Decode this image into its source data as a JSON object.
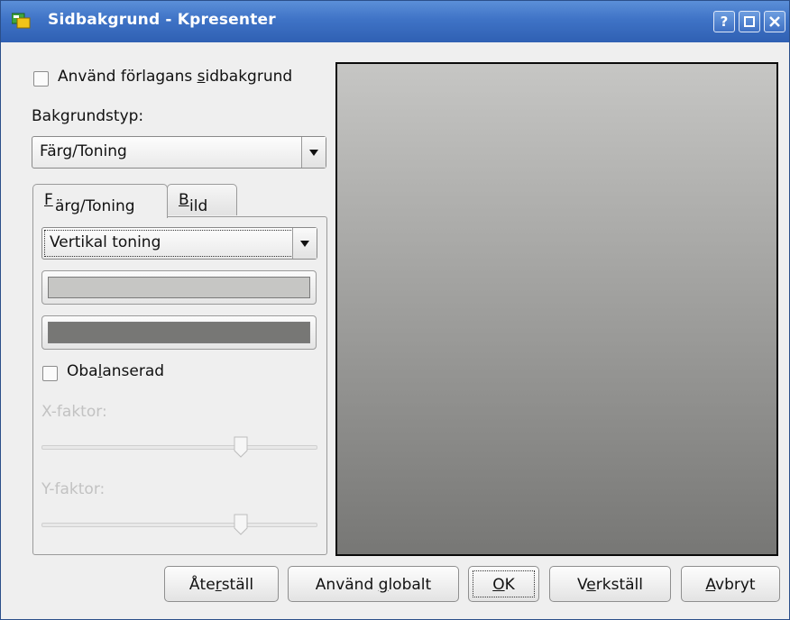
{
  "window": {
    "title": "Sidbakgrund - Kpresenter",
    "help_label": "?"
  },
  "left": {
    "use_template_checkbox": {
      "label_pre": "Använd förlagans ",
      "label_mnemonic": "s",
      "label_post": "idbakgrund",
      "checked": false
    },
    "background_type_label": "Bakgrundstyp:",
    "background_type_value": "Färg/Toning",
    "tabs": [
      {
        "mnemonic": "F",
        "rest": "ärg/Toning",
        "active": true
      },
      {
        "mnemonic": "B",
        "rest": "ild",
        "active": false
      }
    ],
    "gradient_type_value": "Vertikal toning",
    "color1": "#c6c6c4",
    "color2": "#777775",
    "unbalanced": {
      "pre": "Oba",
      "mnemonic": "l",
      "post": "anserad",
      "checked": false
    },
    "x_factor_label": "X-faktor:",
    "y_factor_label": "Y-faktor:",
    "x_factor_level": 0.74,
    "y_factor_level": 0.74
  },
  "preview": {
    "gradient_top": "#c6c6c4",
    "gradient_bottom": "#777775"
  },
  "buttons": {
    "reset": {
      "pre": "Åte",
      "mnemonic": "r",
      "post": "ställ"
    },
    "apply_global": {
      "pre": "Använd ",
      "mnemonic": "g",
      "post": "lobalt"
    },
    "ok": {
      "pre": "",
      "mnemonic": "O",
      "post": "K"
    },
    "apply": {
      "pre": "V",
      "mnemonic": "e",
      "post": "rkställ"
    },
    "cancel": {
      "pre": "",
      "mnemonic": "A",
      "post": "vbryt"
    }
  },
  "colors": {
    "titlebar": "#3f73c6",
    "dialog_bg": "#efefef"
  }
}
